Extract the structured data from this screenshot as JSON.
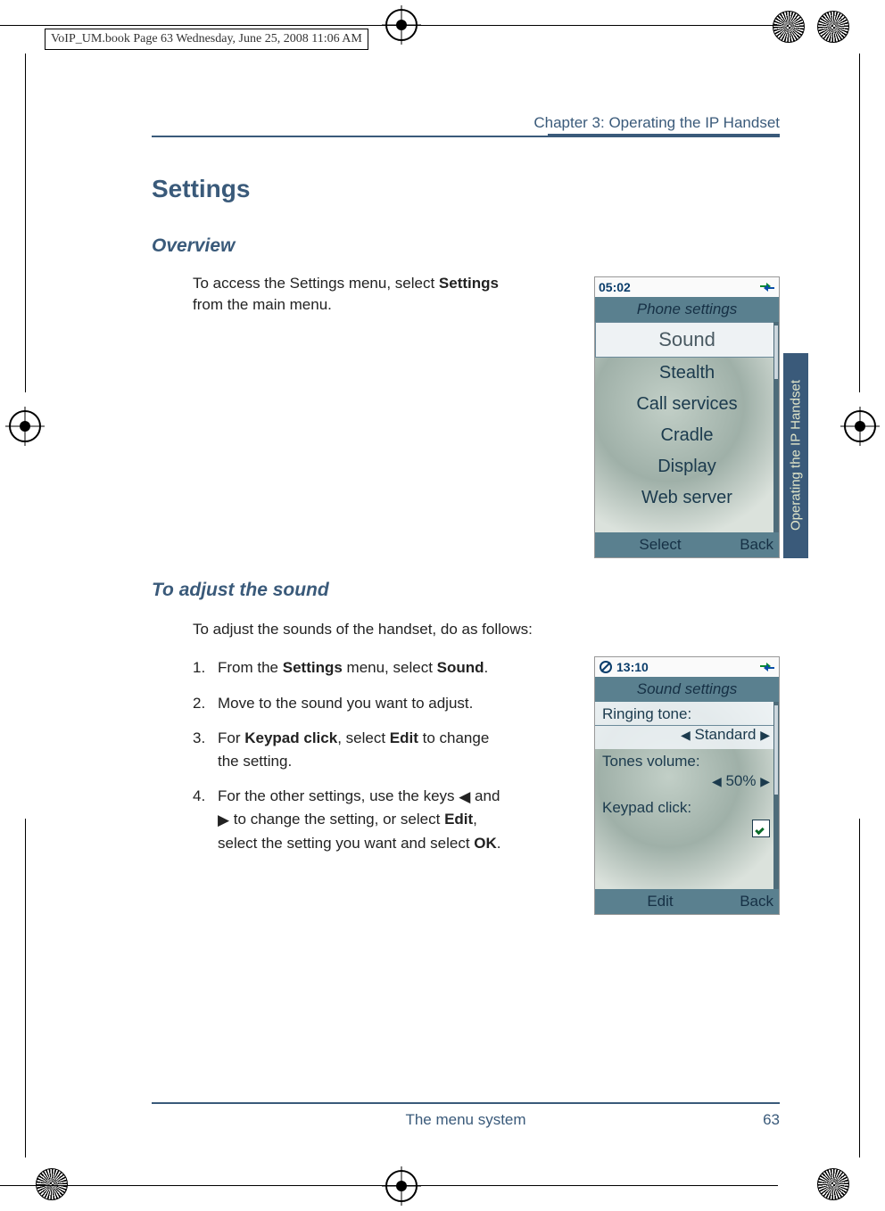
{
  "print_header": "VoIP_UM.book  Page 63  Wednesday, June 25, 2008  11:06 AM",
  "chapter": "Chapter 3:  Operating the IP Handset",
  "side_tab": "Operating the IP Handset",
  "section_title": "Settings",
  "overview": {
    "heading": "Overview",
    "para_pre": "To access the Settings menu, select ",
    "para_bold": "Settings",
    "para_post": " from the main menu."
  },
  "sound": {
    "heading": "To adjust the sound",
    "intro": "To adjust the sounds of the handset, do as follows:",
    "steps": {
      "s1_a": "From the ",
      "s1_b": "Settings",
      "s1_c": " menu, select ",
      "s1_d": "Sound",
      "s1_e": ".",
      "s2": "Move to the sound you want to adjust.",
      "s3_a": "For ",
      "s3_b": "Keypad click",
      "s3_c": ", select ",
      "s3_d": "Edit",
      "s3_e": " to change the setting.",
      "s4_a": "For the other settings, use the keys ",
      "s4_b": " and ",
      "s4_c": " to change the setting, or select ",
      "s4_d": "Edit",
      "s4_e": ", select the setting you want and select ",
      "s4_f": "OK",
      "s4_g": "."
    },
    "nums": {
      "n1": "1.",
      "n2": "2.",
      "n3": "3.",
      "n4": "4."
    }
  },
  "phone1": {
    "time": "05:02",
    "title": "Phone settings",
    "items": [
      "Sound",
      "Stealth",
      "Call services",
      "Cradle",
      "Display",
      "Web server"
    ],
    "soft_left": "Select",
    "soft_right": "Back"
  },
  "phone2": {
    "time": "13:10",
    "title": "Sound settings",
    "rows": {
      "r1_label": "Ringing tone:",
      "r1_value": "Standard",
      "r2_label": "Tones volume:",
      "r2_value": "50%",
      "r3_label": "Keypad click:"
    },
    "soft_left": "Edit",
    "soft_right": "Back"
  },
  "footer": {
    "center": "The menu system",
    "page": "63"
  }
}
